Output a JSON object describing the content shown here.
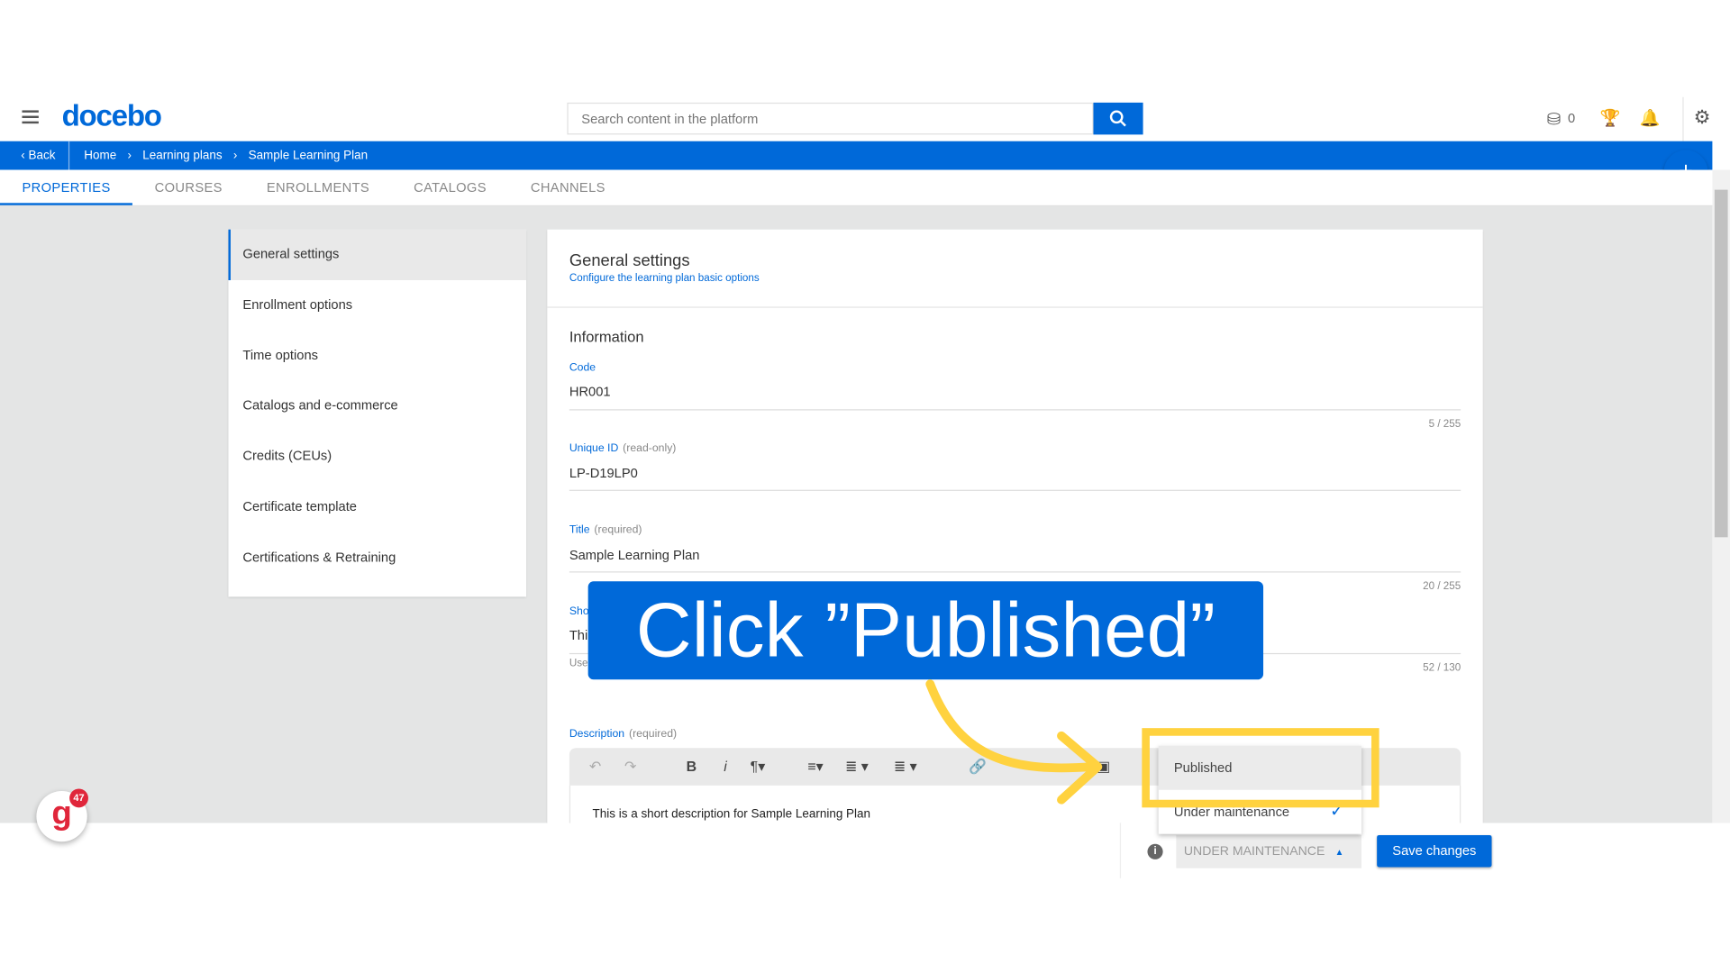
{
  "header": {
    "logo": "docebo",
    "search_placeholder": "Search content in the platform",
    "credits_count": "0"
  },
  "breadcrumb": {
    "back": "Back",
    "items": [
      "Home",
      "Learning plans",
      "Sample Learning Plan"
    ]
  },
  "tabs": [
    {
      "label": "PROPERTIES",
      "active": true
    },
    {
      "label": "COURSES"
    },
    {
      "label": "ENROLLMENTS"
    },
    {
      "label": "CATALOGS"
    },
    {
      "label": "CHANNELS"
    }
  ],
  "sidebar": {
    "items": [
      "General settings",
      "Enrollment options",
      "Time options",
      "Catalogs and e-commerce",
      "Credits (CEUs)",
      "Certificate template",
      "Certifications & Retraining"
    ]
  },
  "main": {
    "title": "General settings",
    "subtitle": "Configure the learning plan basic options",
    "section": "Information",
    "code": {
      "label": "Code",
      "value": "HR001",
      "count": "5 / 255"
    },
    "unique_id": {
      "label": "Unique ID",
      "note": "(read-only)",
      "value": "LP-D19LP0"
    },
    "title_field": {
      "label": "Title",
      "note": "(required)",
      "value": "Sample Learning Plan",
      "count": "20 / 255"
    },
    "short_desc": {
      "label": "Sho",
      "value": "Thi",
      "hint": "Use",
      "count": "52 / 130"
    },
    "description": {
      "label": "Description",
      "note": "(required)",
      "value": "This is a short description for Sample Learning Plan"
    }
  },
  "dropdown": {
    "options": [
      "Published",
      "Under maintenance"
    ],
    "selected": "Under maintenance"
  },
  "footer": {
    "status": "UNDER MAINTENANCE",
    "save": "Save changes"
  },
  "overlay": {
    "instruction": "Click ”Published”"
  },
  "badge": {
    "count": "47"
  },
  "colors": {
    "primary": "#0069d9",
    "highlight": "#ffd23f"
  }
}
